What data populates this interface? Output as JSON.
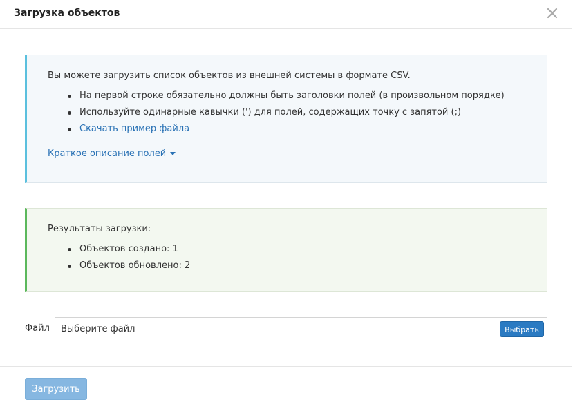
{
  "modal": {
    "title": "Загрузка объектов"
  },
  "info": {
    "intro": "Вы можете загрузить список объектов из внешней системы в формате CSV.",
    "bullets": [
      "На первой строке обязательно должны быть заголовки полей (в произвольном порядке)",
      "Используйте одинарные кавычки (') для полей, содержащих точку с запятой (;)"
    ],
    "download_link": "Скачать пример файла",
    "fields_toggle": "Краткое описание полей"
  },
  "results": {
    "title": "Результаты загрузки:",
    "items": [
      "Объектов создано: 1",
      "Объектов обновлено: 2"
    ]
  },
  "file": {
    "label": "Файл",
    "placeholder": "Выберите файл",
    "choose_label": "Выбрать"
  },
  "footer": {
    "submit_label": "Загрузить"
  },
  "colors": {
    "info_accent": "#5bc0de",
    "success_accent": "#5cb85c",
    "link": "#2a72b5",
    "primary_button": "#2a7ac2",
    "disabled_button": "#86b7e1"
  }
}
